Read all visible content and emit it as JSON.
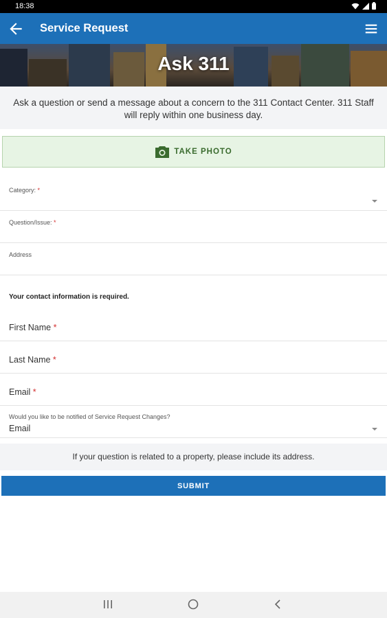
{
  "status_bar": {
    "time": "18:38"
  },
  "app_bar": {
    "title": "Service Request"
  },
  "banner": {
    "title": "Ask 311"
  },
  "intro_text": "Ask a question or send a message about a concern to the 311 Contact Center. 311 Staff will reply within one business day.",
  "photo_button": {
    "label": "TAKE PHOTO"
  },
  "fields": {
    "category": {
      "label": "Category: ",
      "required_mark": "*"
    },
    "question": {
      "label": "Question/Issue: ",
      "required_mark": "*"
    },
    "address": {
      "label": "Address"
    }
  },
  "contact": {
    "note": "Your contact information is required.",
    "first_name": {
      "label": "First Name ",
      "required_mark": "*"
    },
    "last_name": {
      "label": "Last Name ",
      "required_mark": "*"
    },
    "email": {
      "label": "Email ",
      "required_mark": "*"
    },
    "notify": {
      "label": "Would you like to be notified of Service Request Changes?",
      "value": "Email"
    }
  },
  "property_note": "If your question is related to a property, please include its address.",
  "submit_label": "SUBMIT",
  "colors": {
    "primary": "#1d70b8",
    "photo_bg": "#e7f4e4",
    "photo_text": "#3a6b2e",
    "required": "#d32f2f"
  },
  "icons": {
    "back": "arrow-left-icon",
    "menu": "hamburger-menu-icon",
    "camera": "camera-icon"
  }
}
